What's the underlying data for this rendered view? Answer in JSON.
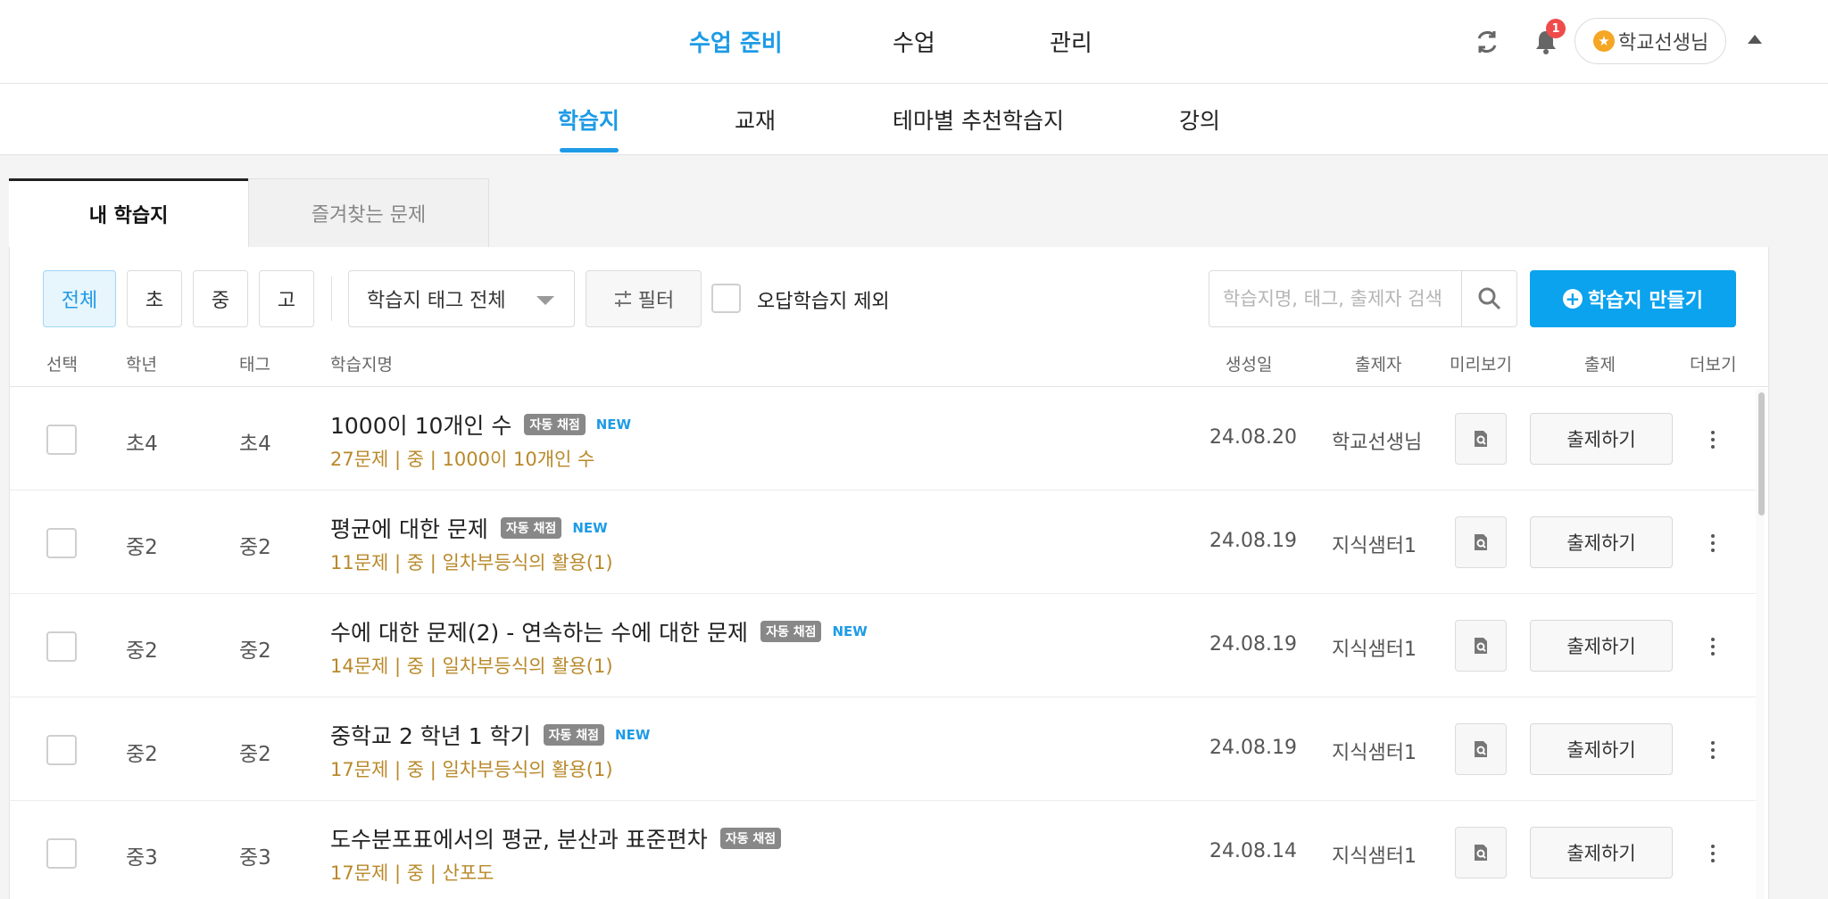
{
  "main_nav": [
    {
      "label": "수업 준비",
      "active": true
    },
    {
      "label": "수업",
      "active": false
    },
    {
      "label": "관리",
      "active": false
    }
  ],
  "header": {
    "notification_count": "1",
    "user_name": "학교선생님",
    "icons": [
      "refresh-icon",
      "bell-icon",
      "star-icon",
      "caret-up-icon"
    ]
  },
  "sub_nav": [
    {
      "label": "학습지",
      "active": true
    },
    {
      "label": "교재",
      "active": false
    },
    {
      "label": "테마별 추천학습지",
      "active": false
    },
    {
      "label": "강의",
      "active": false
    }
  ],
  "tabs": [
    {
      "label": "내 학습지",
      "active": true
    },
    {
      "label": "즐겨찾는 문제",
      "active": false
    }
  ],
  "toolbar": {
    "grades": [
      "전체",
      "초",
      "중",
      "고"
    ],
    "tag_select": "학습지 태그 전체",
    "filter_label": "필터",
    "exclude_label": "오답학습지 제외",
    "search_placeholder": "학습지명, 태그, 출제자 검색",
    "create_label": "학습지 만들기"
  },
  "columns": [
    "선택",
    "학년",
    "태그",
    "학습지명",
    "생성일",
    "출제자",
    "미리보기",
    "출제",
    "더보기"
  ],
  "rows": [
    {
      "grade": "초4",
      "tag": "초4",
      "title": "1000이 10개인 수",
      "auto": "자동 채점",
      "new": "NEW",
      "meta": "27문제 | 중 | 1000이 10개인 수",
      "date": "24.08.20",
      "author": "학교선생님",
      "assign": "출제하기"
    },
    {
      "grade": "중2",
      "tag": "중2",
      "title": "평균에 대한 문제",
      "auto": "자동 채점",
      "new": "NEW",
      "meta": "11문제 | 중 | 일차부등식의 활용(1)",
      "date": "24.08.19",
      "author": "지식샘터1",
      "assign": "출제하기"
    },
    {
      "grade": "중2",
      "tag": "중2",
      "title": "수에 대한 문제(2) - 연속하는 수에 대한 문제",
      "auto": "자동 채점",
      "new": "NEW",
      "meta": "14문제 | 중 | 일차부등식의 활용(1)",
      "date": "24.08.19",
      "author": "지식샘터1",
      "assign": "출제하기"
    },
    {
      "grade": "중2",
      "tag": "중2",
      "title": "중학교 2 학년 1 학기",
      "auto": "자동 채점",
      "new": "NEW",
      "meta": "17문제 | 중 | 일차부등식의 활용(1)",
      "date": "24.08.19",
      "author": "지식샘터1",
      "assign": "출제하기"
    },
    {
      "grade": "중3",
      "tag": "중3",
      "title": "도수분포표에서의 평균, 분산과 표준편차",
      "auto": "자동 채점",
      "new": "",
      "meta": "17문제 | 중 | 산포도",
      "date": "24.08.14",
      "author": "지식샘터1",
      "assign": "출제하기"
    }
  ],
  "colors": {
    "accent": "#1e9be6",
    "meta": "#b8892a",
    "create_button": "#0ba2ee",
    "badge": "#f04b4b"
  }
}
